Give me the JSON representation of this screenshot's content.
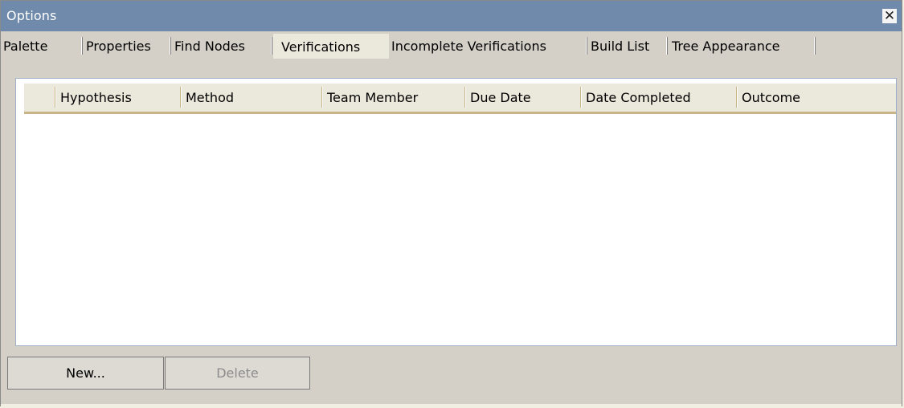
{
  "window": {
    "title": "Options",
    "close_glyph": "✕"
  },
  "tabs": [
    {
      "label": "Palette",
      "active": false
    },
    {
      "label": "Properties",
      "active": false
    },
    {
      "label": "Find Nodes",
      "active": false
    },
    {
      "label": "Verifications",
      "active": true
    },
    {
      "label": "Incomplete Verifications",
      "active": false
    },
    {
      "label": "Build List",
      "active": false
    },
    {
      "label": "Tree Appearance",
      "active": false
    }
  ],
  "list": {
    "columns": [
      "Hypothesis",
      "Method",
      "Team Member",
      "Due Date",
      "Date Completed",
      "Outcome"
    ],
    "rows": []
  },
  "buttons": {
    "new_label": "New...",
    "delete_label": "Delete",
    "delete_enabled": false
  },
  "colors": {
    "titlebar": "#6f8aaa",
    "header_underline": "#c8b487",
    "list_border": "#9db0c8"
  }
}
